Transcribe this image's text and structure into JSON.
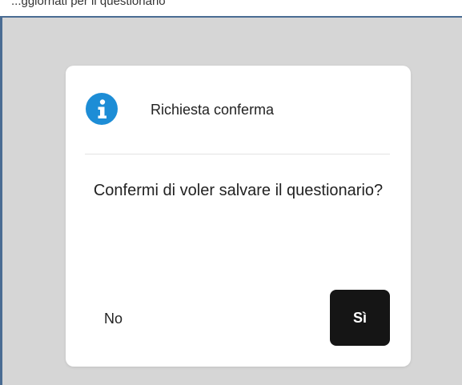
{
  "background_page": {
    "top_text": "...ggiornati per il questionario"
  },
  "dialog": {
    "icon": "info-icon",
    "title": "Richiesta conferma",
    "message": "Confermi di voler salvare il questionario?",
    "buttons": {
      "no_label": "No",
      "yes_label": "Sì"
    }
  },
  "colors": {
    "info_icon": "#1d8dd6",
    "primary_button": "#151515",
    "overlay": "#d6d6d6",
    "frame_border": "#4a6c93"
  }
}
